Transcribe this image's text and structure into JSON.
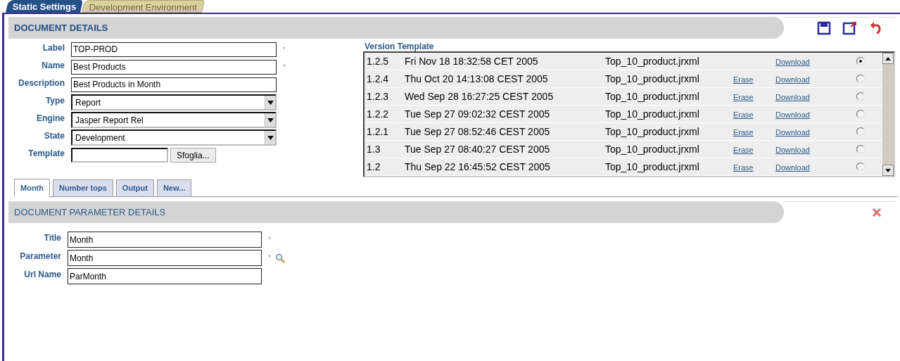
{
  "main_tabs": [
    {
      "label": "Static Settings",
      "selected": true
    },
    {
      "label": "Development Environment",
      "selected": false
    }
  ],
  "document_details": {
    "title": "DOCUMENT DETAILS",
    "fields": [
      {
        "kind": "text",
        "label": "Label",
        "value": "TOP-PROD",
        "required_mark": "*"
      },
      {
        "kind": "text",
        "label": "Name",
        "value": "Best Products",
        "required_mark": "*"
      },
      {
        "kind": "text",
        "label": "Description",
        "value": "Best Products in Month"
      },
      {
        "kind": "select",
        "label": "Type",
        "value": "Report"
      },
      {
        "kind": "select",
        "label": "Engine",
        "value": "Jasper Report Rel"
      },
      {
        "kind": "select",
        "label": "State",
        "value": "Development"
      },
      {
        "kind": "file",
        "label": "Template",
        "button": "Sfoglia..."
      }
    ]
  },
  "version_template": {
    "title": "Version Template",
    "rows": [
      {
        "version": "1.2.5",
        "date": "Fri Nov 18 18:32:58 CET 2005",
        "file": "Top_10_product.jrxml",
        "download": "Download",
        "selected": true
      },
      {
        "version": "1.2.4",
        "date": "Thu Oct 20 14:13:08 CEST 2005",
        "file": "Top_10_product.jrxml",
        "erase": "Erase",
        "download": "Download",
        "selected": false
      },
      {
        "version": "1.2.3",
        "date": "Wed Sep 28 16:27:25 CEST 2005",
        "file": "Top_10_product.jrxml",
        "erase": "Erase",
        "download": "Download",
        "selected": false
      },
      {
        "version": "1.2.2",
        "date": "Tue Sep 27 09:02:32 CEST 2005",
        "file": "Top_10_product.jrxml",
        "erase": "Erase",
        "download": "Download",
        "selected": false
      },
      {
        "version": "1.2.1",
        "date": "Tue Sep 27 08:52:46 CEST 2005",
        "file": "Top_10_product.jrxml",
        "erase": "Erase",
        "download": "Download",
        "selected": false
      },
      {
        "version": "1.3",
        "date": "Tue Sep 27 08:40:27 CEST 2005",
        "file": "Top_10_product.jrxml",
        "erase": "Erase",
        "download": "Download",
        "selected": false
      },
      {
        "version": "1.2",
        "date": "Thu Sep 22 16:45:52 CEST 2005",
        "file": "Top_10_product.jrxml",
        "erase": "Erase",
        "download": "Download",
        "selected": false
      }
    ]
  },
  "parameter_tabs": [
    {
      "label": "Month",
      "selected": true
    },
    {
      "label": "Number tops",
      "selected": false
    },
    {
      "label": "Output",
      "selected": false
    },
    {
      "label": "New...",
      "selected": false
    }
  ],
  "parameter_details": {
    "title": "DOCUMENT PARAMETER DETAILS",
    "fields": [
      {
        "label": "Title",
        "value": "Month",
        "required_mark": "*"
      },
      {
        "label": "Parameter",
        "value": "Month",
        "required_mark": "*",
        "lookup": true
      },
      {
        "label": "Url Name",
        "value": "ParMonth"
      }
    ]
  }
}
